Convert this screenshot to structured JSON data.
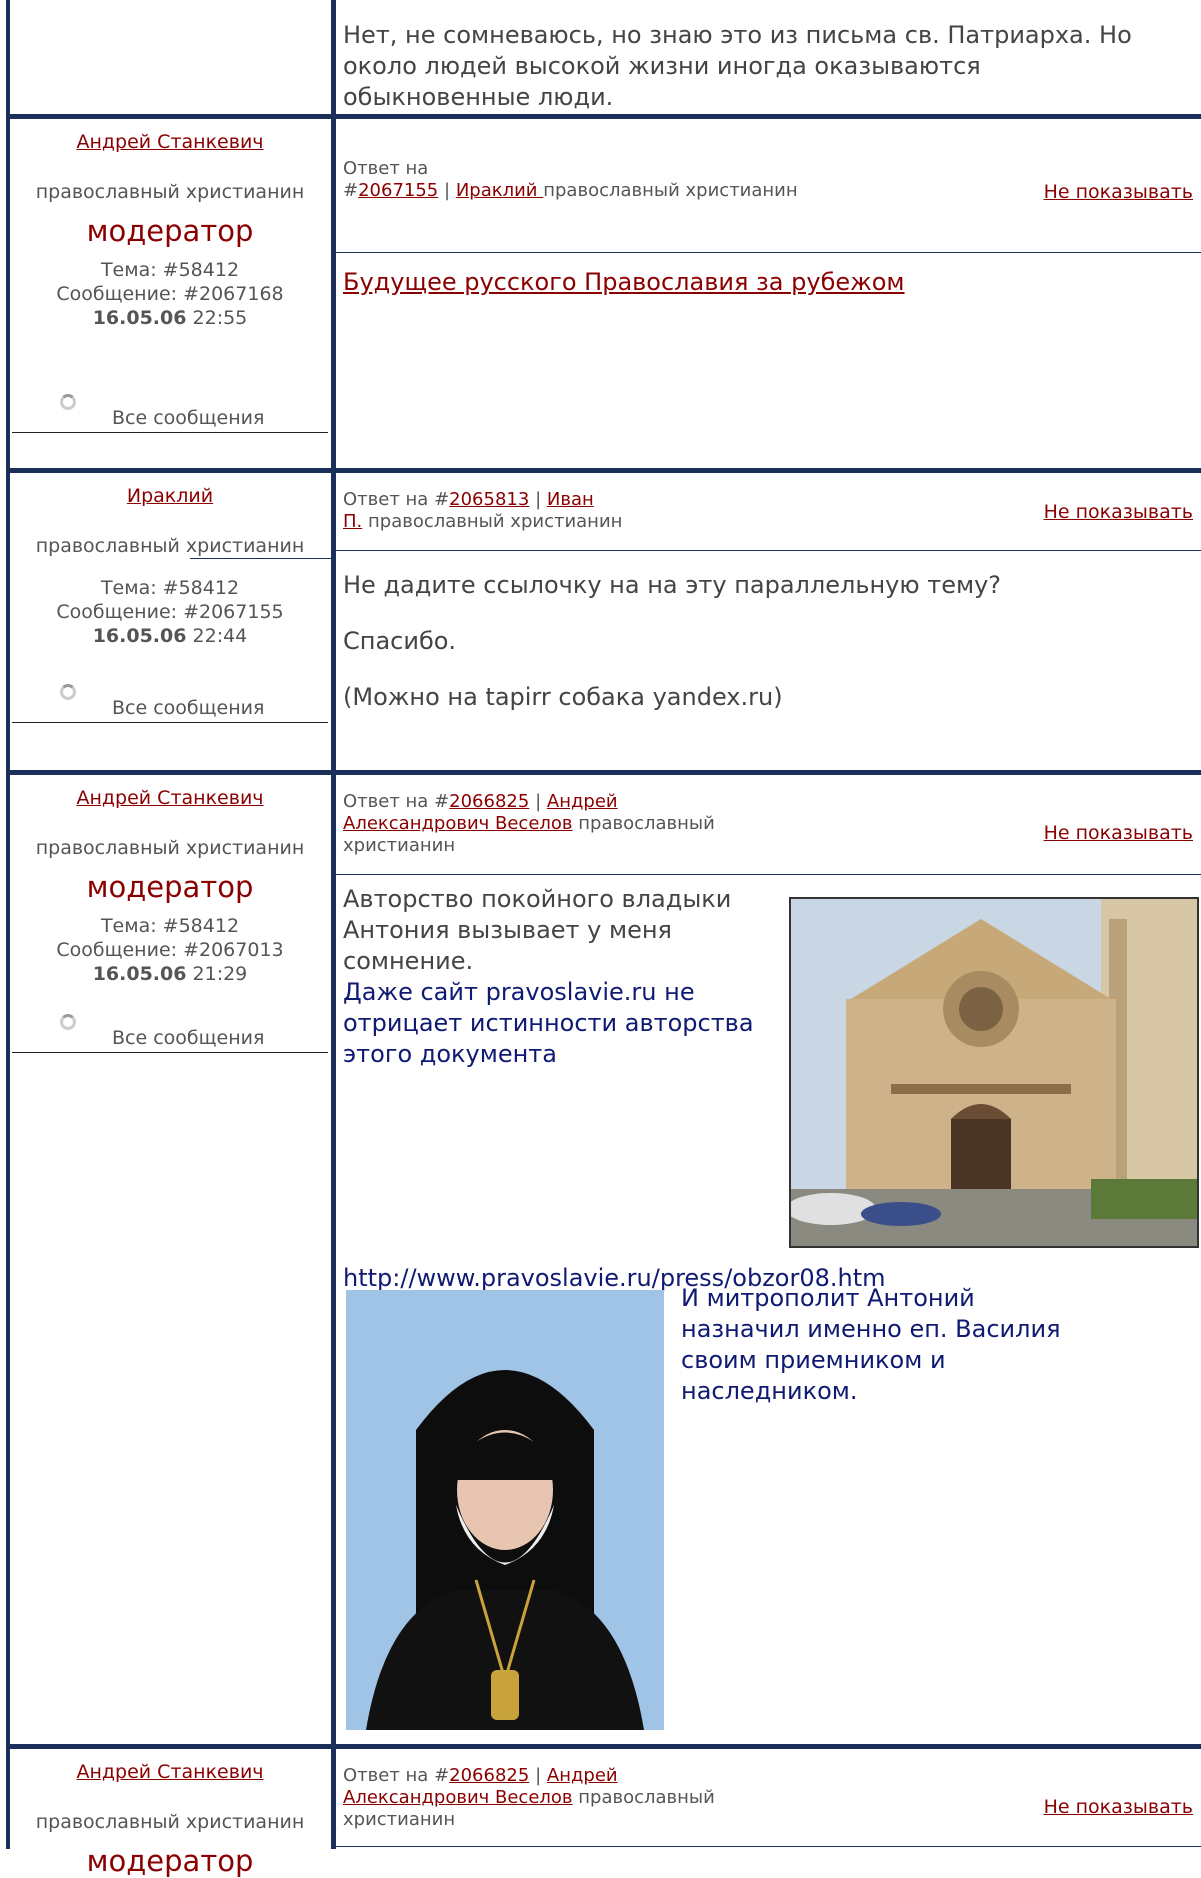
{
  "top_post": {
    "body": "Нет, не сомневаюсь, но знаю это из письма св. Патриарха. Но около людей высокой жизни иногда оказываются обыкновенные люди."
  },
  "posts": [
    {
      "author": "Андрей Станкевич",
      "role": "православный христианин",
      "badge": "модератор",
      "topic": "Тема: #58412",
      "message": "Сообщение: #2067168",
      "date": "16.05.06",
      "time": "22:55",
      "all_messages": "Все сообщения",
      "reply_prefix": "Ответ на",
      "reply_hash": "#",
      "reply_id": "2067155",
      "reply_sep": "|",
      "reply_author": "Ираклий ",
      "reply_role": "православный христианин",
      "hide": "Не показывать",
      "title_link": "Будущее русского Православия за рубежом"
    },
    {
      "author": "Ираклий",
      "role": "православный христианин",
      "topic": "Тема: #58412",
      "message": "Сообщение: #2067155",
      "date": "16.05.06",
      "time": "22:44",
      "all_messages": "Все сообщения",
      "reply_prefix": "Ответ на #",
      "reply_id": "2065813",
      "reply_sep": "|",
      "reply_author_1": "Иван",
      "reply_author_2": "П.",
      "reply_role": "православный христианин",
      "hide": "Не показывать",
      "lines": [
        "Не дадите ссылочку на на эту параллельную тему?",
        "Спасибо.",
        "(Можно на tapirr собака yandex.ru)"
      ]
    },
    {
      "author": "Андрей Станкевич",
      "role": "православный христианин",
      "badge": "модератор",
      "topic": "Тема: #58412",
      "message": "Сообщение: #2067013",
      "date": "16.05.06",
      "time": "21:29",
      "all_messages": "Все сообщения",
      "reply_prefix": "Ответ на #",
      "reply_id": "2066825",
      "reply_sep": "|",
      "reply_author_1": "Андрей",
      "reply_author_2": "Александрович Веселов",
      "reply_role_1": "православный",
      "reply_role_2": "христианин",
      "hide": "Не показывать",
      "quote": "Авторство покойного владыки Антония вызывает у меня сомнение.",
      "answer": "Даже сайт pravoslavie.ru не отрицает истинности авторства этого документа",
      "url": "http://www.pravoslavie.ru/press/obzor08.htm",
      "answer2": "И митрополит Антоний назначил именно еп. Василия своим приемником и наследником."
    },
    {
      "author": "Андрей Станкевич",
      "role": "православный христианин",
      "badge": "модератор",
      "reply_prefix": "Ответ на #",
      "reply_id": "2066825",
      "reply_sep": "|",
      "reply_author_1": "Андрей",
      "reply_author_2": "Александрович Веселов",
      "reply_role_1": "православный",
      "reply_role_2": "христианин",
      "hide": "Не показывать"
    }
  ],
  "colors": {
    "link": "#8b0000",
    "frame": "#1a2f5a",
    "answer_text": "#0f1a73"
  }
}
